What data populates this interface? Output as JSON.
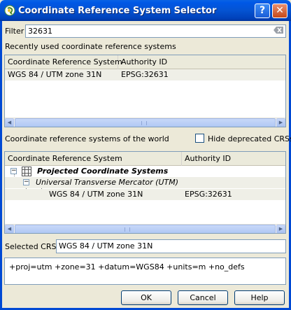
{
  "window": {
    "title": "Coordinate Reference System Selector",
    "help_button": "?",
    "close_button": "✕"
  },
  "filter": {
    "label": "Filter",
    "value": "32631"
  },
  "recent": {
    "label": "Recently used coordinate reference systems",
    "columns": [
      "Coordinate Reference System",
      "Authority ID"
    ],
    "rows": [
      {
        "name": "WGS 84 / UTM zone 31N",
        "authority": "EPSG:32631"
      }
    ]
  },
  "world": {
    "label": "Coordinate reference systems of the world",
    "hide_deprecated_label": "Hide deprecated CRSs",
    "hide_deprecated_checked": false,
    "columns": [
      "Coordinate Reference System",
      "Authority ID"
    ],
    "tree": {
      "group": "Projected Coordinate Systems",
      "subgroup": "Universal Transverse Mercator (UTM)",
      "item": {
        "name": "WGS 84 / UTM zone 31N",
        "authority": "EPSG:32631"
      }
    }
  },
  "selected": {
    "label": "Selected CRS:",
    "value": "WGS 84 / UTM zone 31N"
  },
  "proj_string": "+proj=utm +zone=31 +datum=WGS84 +units=m +no_defs",
  "buttons": {
    "ok": "OK",
    "cancel": "Cancel",
    "help": "Help"
  },
  "colors": {
    "titlebar": "#0453d2",
    "dialog_bg": "#ece9d8",
    "selected_row": "#efefe7"
  }
}
